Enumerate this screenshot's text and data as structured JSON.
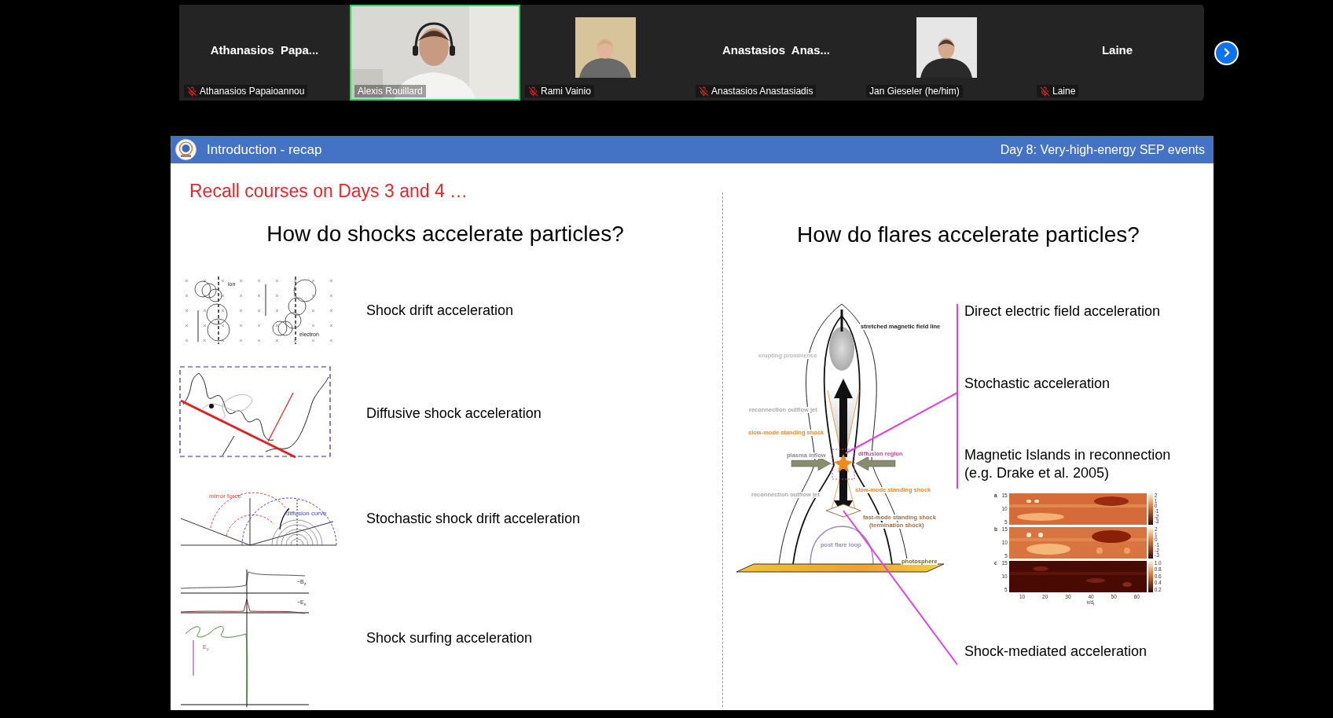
{
  "meeting": {
    "participants": [
      {
        "kind": "name",
        "name": "Athanasios  Papa...",
        "label": "Athanasios Papaioannou",
        "muted": true,
        "speaking": false
      },
      {
        "kind": "video",
        "label": "Alexis Rouillard",
        "muted": false,
        "speaking": true
      },
      {
        "label": "Rami Vainio",
        "muted": true,
        "speaking": false
      },
      {
        "kind": "name",
        "name": "Anastasios  Anas...",
        "label": "Anastasios Anastasiadis",
        "muted": true,
        "speaking": false
      },
      {
        "label": "Jan Gieseler (he/him)",
        "muted": false,
        "speaking": false
      },
      {
        "kind": "name",
        "name": "Laine",
        "label": "Laine",
        "muted": true,
        "speaking": false
      }
    ]
  },
  "slide": {
    "header": {
      "title": "Introduction - recap",
      "subtitle": "Day 8: Very-high-energy SEP events"
    },
    "note": "Recall courses on Days 3 and 4 …",
    "left": {
      "title": "How do shocks accelerate particles?",
      "methods": [
        {
          "label": "Shock drift acceleration",
          "kind": "drift",
          "figure_labels": [
            "ion",
            "electron"
          ]
        },
        {
          "label": "Diffusive shock acceleration",
          "kind": "diffusive"
        },
        {
          "label": "Stochastic shock drift acceleration",
          "kind": "sda",
          "figure_labels": [
            "mirror force",
            "diffusion curve"
          ]
        },
        {
          "label": "Shock surfing acceleration",
          "kind": "surfing",
          "figure_labels": [
            "−B$_{z}$",
            "−E$_{x}$",
            "E$_{y}$"
          ]
        }
      ]
    },
    "right": {
      "title": "How do flares accelerate particles?",
      "flare_labels": [
        {
          "text": "stretched magnetic field line",
          "color": "#222222"
        },
        {
          "text": "erupting prominence",
          "color": "#b8b8b8"
        },
        {
          "text": "reconnection outflow jet",
          "color": "#a8a8a8"
        },
        {
          "text": "slow-mode standing shock",
          "color": "#e8892c"
        },
        {
          "text": "plasma inflow",
          "color": "#8a8a8a"
        },
        {
          "text": "diffusion region",
          "color": "#c04a9a"
        },
        {
          "text": "reconnection outflow jet",
          "color": "#a8a8a8"
        },
        {
          "text": "slow-mode standing shock",
          "color": "#e8892c"
        },
        {
          "text": "fast-mode standing shock",
          "color": "#a0704a"
        },
        {
          "text": "(termination shock)",
          "color": "#a0704a"
        },
        {
          "text": "post flare loop",
          "color": "#9a8ac8"
        },
        {
          "text": "photosphere",
          "color": "#7a6a2a"
        }
      ],
      "methods": [
        {
          "kind": "text",
          "label": "Direct electric field acceleration"
        },
        {
          "kind": "text",
          "label": "Stochastic acceleration"
        },
        {
          "kind": "text",
          "label": "Magnetic Islands in reconnection\n(e.g. Drake et al. 2005)"
        },
        {
          "kind": "heatmap",
          "panels": [
            {
              "letter": "a",
              "yticks": [
                "15",
                "10",
                "5"
              ],
              "cticks": [
                "2",
                "1",
                "0",
                "-1",
                "-2",
                "-3"
              ]
            },
            {
              "letter": "b",
              "yticks": [
                "15",
                "10",
                "5"
              ],
              "cticks": [
                "2",
                "1",
                "0",
                "-1",
                "-2",
                "-3"
              ]
            },
            {
              "letter": "c",
              "yticks": [
                "15",
                "10",
                "5"
              ],
              "cticks": [
                "1.0",
                "0.8",
                "0.6",
                "0.4",
                "0.2"
              ]
            }
          ],
          "xticks": [
            "10",
            "20",
            "30",
            "40",
            "50",
            "60"
          ],
          "xlabel": "x/d$_{i}$"
        },
        {
          "kind": "text",
          "label": "Shock-mediated acceleration"
        }
      ]
    }
  }
}
